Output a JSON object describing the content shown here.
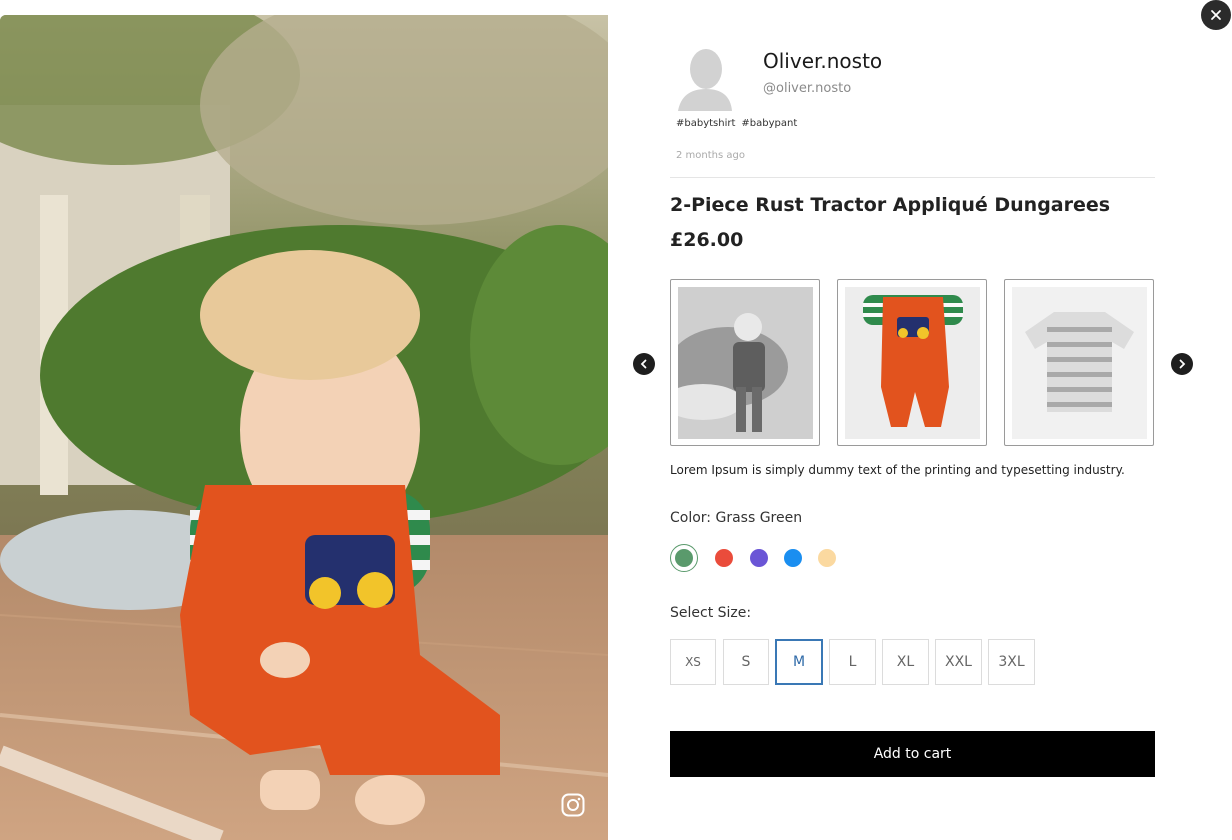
{
  "post": {
    "username": "Oliver.nosto",
    "handle": "@oliver.nosto",
    "tags": [
      "#babytshirt",
      "#babypant"
    ],
    "time_ago": "2 months ago"
  },
  "product": {
    "title": "2-Piece Rust Tractor Appliqué Dungarees",
    "price": "£26.00",
    "description": "Lorem Ipsum is simply dummy text of the printing and typesetting industry."
  },
  "color": {
    "label": "Color: Grass Green",
    "swatches": [
      "#5a9a6c",
      "#ea4c3b",
      "#6a55d6",
      "#1a8ef0",
      "#fbd9a0"
    ],
    "selected_index": 0
  },
  "size": {
    "label": "Select Size:",
    "options": [
      "XS",
      "S",
      "M",
      "L",
      "XL",
      "XXL",
      "3XL"
    ],
    "selected": "M"
  },
  "cart": {
    "label": "Add to cart"
  },
  "icons": {
    "close": "close-icon",
    "instagram": "instagram-icon",
    "prev": "chevron-left-icon",
    "next": "chevron-right-icon"
  }
}
